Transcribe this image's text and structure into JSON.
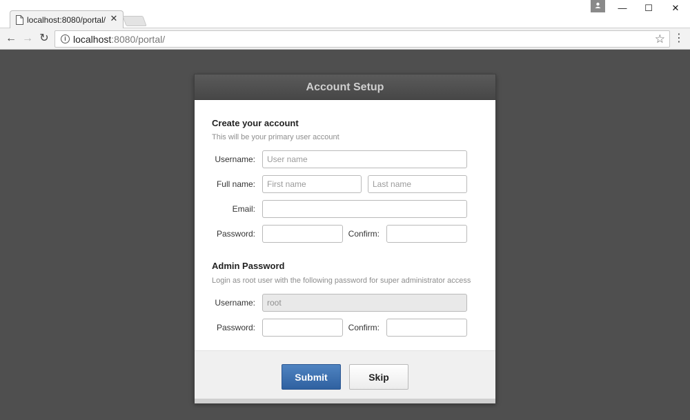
{
  "browser": {
    "tab_title": "localhost:8080/portal/",
    "tab_close": "✕",
    "url_host": "localhost",
    "url_path": ":8080/portal/",
    "window_controls": {
      "minimize": "—",
      "maximize": "☐",
      "close": "✕"
    },
    "nav": {
      "back": "←",
      "forward": "→",
      "reload": "↻",
      "menu": "⋮",
      "star": "☆",
      "info": "i"
    }
  },
  "dialog": {
    "title": "Account Setup",
    "account_section": {
      "title": "Create your account",
      "subtitle": "This will be your primary user account",
      "username_label": "Username:",
      "username_placeholder": "User name",
      "fullname_label": "Full name:",
      "firstname_placeholder": "First name",
      "lastname_placeholder": "Last name",
      "email_label": "Email:",
      "password_label": "Password:",
      "confirm_label": "Confirm:"
    },
    "admin_section": {
      "title": "Admin Password",
      "subtitle": "Login as root user with the following password for super administrator access",
      "username_label": "Username:",
      "username_value": "root",
      "password_label": "Password:",
      "confirm_label": "Confirm:"
    },
    "buttons": {
      "submit": "Submit",
      "skip": "Skip"
    }
  }
}
